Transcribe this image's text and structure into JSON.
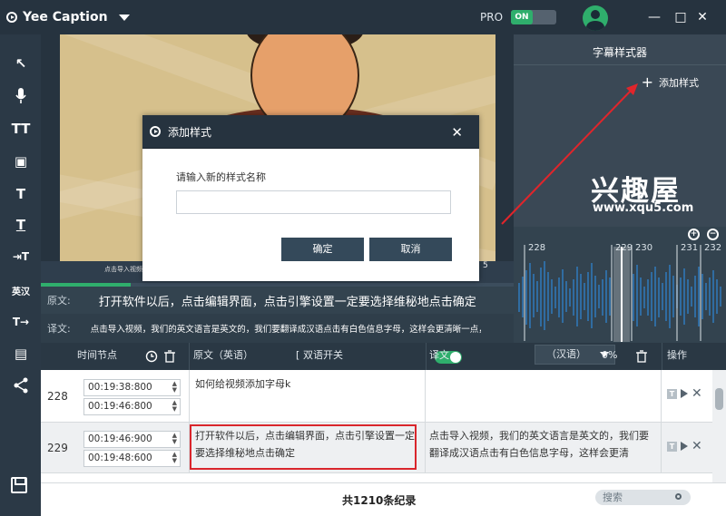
{
  "app": {
    "title": "Yee Caption",
    "pro_label": "PRO",
    "pro_toggle": "ON"
  },
  "window": {
    "minimize": "—",
    "maximize": "□",
    "close": "✕"
  },
  "toolbar": {
    "items": [
      {
        "name": "cursor-tool",
        "glyph": "↖"
      },
      {
        "name": "microphone-tool",
        "glyph": "🎙"
      },
      {
        "name": "text-tool",
        "glyph": "TT"
      },
      {
        "name": "shape-tool",
        "glyph": "▣"
      },
      {
        "name": "voice-text-tool",
        "glyph": "T"
      },
      {
        "name": "subtitle-tool",
        "glyph": "T"
      },
      {
        "name": "import-text-tool",
        "glyph": "⇥T"
      },
      {
        "name": "translate-tool",
        "glyph": "英汉"
      },
      {
        "name": "export-text-tool",
        "glyph": "T→"
      },
      {
        "name": "film-tool",
        "glyph": "▤"
      },
      {
        "name": "share-tool",
        "glyph": "⋖"
      }
    ]
  },
  "video": {
    "subtitle_overlay": "点击导入视频",
    "timecode_peek": "5",
    "progress_fraction": 0.19
  },
  "strips": {
    "source_label": "原文:",
    "source_text": "打开软件以后，点击编辑界面，点击引擎设置一定要选择维秘地点击确定",
    "translation_label": "译文:",
    "translation_text": "点击导入视频，我们的英文语言是英文的，我们要翻译成汉语点击有白色信息字母，这样会更清晰一点，一点击自动"
  },
  "style_panel": {
    "tab": "字幕样式器",
    "add_style": "添加样式",
    "brand": "兴趣屋",
    "brand_url": "www.xqu5.com"
  },
  "waveform": {
    "ticks": [
      "228",
      "229",
      "230",
      "231",
      "232"
    ]
  },
  "dialog": {
    "title": "添加样式",
    "prompt": "请输入新的样式名称",
    "input_value": "",
    "confirm": "确定",
    "cancel": "取消"
  },
  "table": {
    "headers": {
      "time": "时间节点",
      "source": "原文（英语）",
      "dual_prefix": "[",
      "dual": "双语开关",
      "translation": "译文",
      "lang": "（汉语）",
      "percent": "0%",
      "ops": "操作"
    },
    "rows": [
      {
        "index": "228",
        "start": "00:19:38:800",
        "end": "00:19:46:800",
        "source": "如何给视频添加字母k",
        "translation": ""
      },
      {
        "index": "229",
        "start": "00:19:46:900",
        "end": "00:19:48:600",
        "source": "打开软件以后，点击编辑界面，点击引擎设置一定要选择维秘地点击确定",
        "translation": "点击导入视频，我们的英文语言是英文的，我们要翻译成汉语点击有白色信息字母，这样会更清"
      }
    ]
  },
  "footer": {
    "count": "共1210条纪录",
    "search_placeholder": "搜索"
  },
  "colors": {
    "accent_green": "#2fae6c",
    "dark": "#26333f",
    "highlight_red": "#d9262c"
  }
}
